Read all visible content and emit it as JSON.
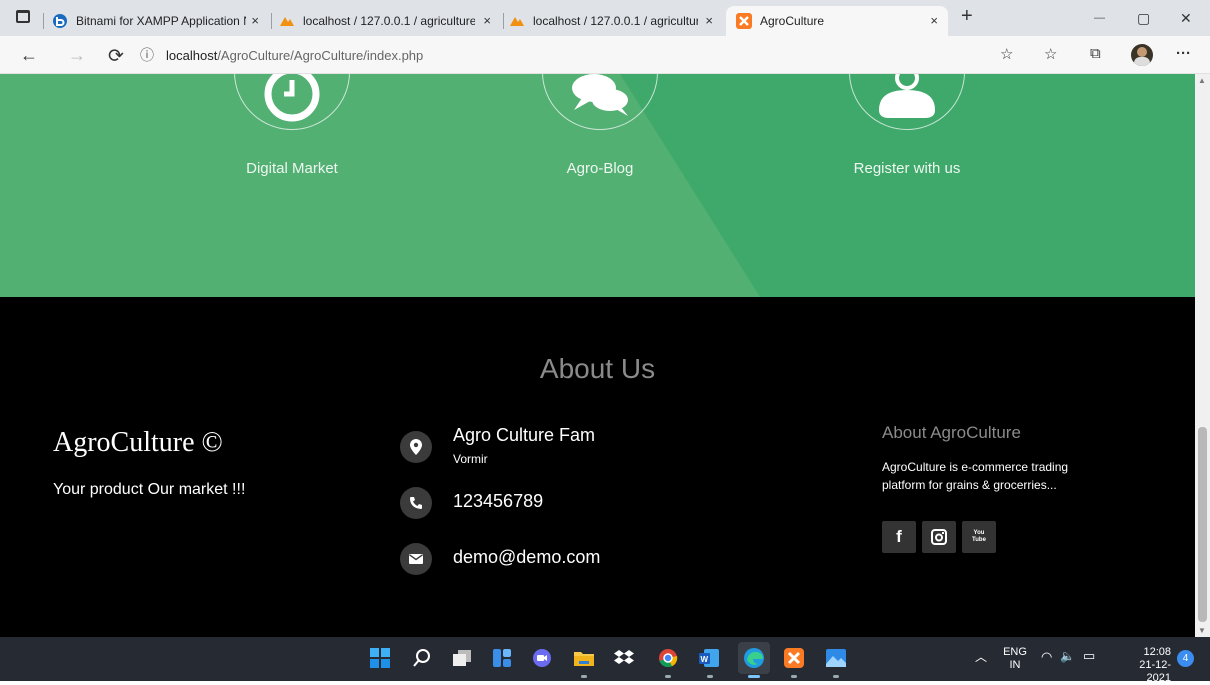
{
  "browser": {
    "tabs": [
      {
        "title": "Bitnami for XAMPP Application N",
        "close": "×"
      },
      {
        "title": "localhost / 127.0.0.1 / agriculture",
        "close": "×"
      },
      {
        "title": "localhost / 127.0.0.1 / agricultur",
        "close": "×"
      },
      {
        "title": "AgroCulture",
        "close": "×"
      }
    ],
    "new_tab": "+",
    "window_controls": {
      "minimize": "—",
      "maximize": "▢",
      "close": "✕"
    },
    "address": {
      "host": "localhost",
      "path": "/AgroCulture/AgroCulture/index.php",
      "info_icon": "ⓘ"
    }
  },
  "features": [
    {
      "label": "Digital Market",
      "icon": "clock-icon"
    },
    {
      "label": "Agro-Blog",
      "icon": "chat-bubbles-icon"
    },
    {
      "label": "Register with us",
      "icon": "user-icon"
    }
  ],
  "footer": {
    "title": "About Us",
    "brand": "AgroCulture ©",
    "tagline": "Your product Our market !!!",
    "contact": {
      "name": "Agro Culture Fam",
      "place": "Vormir",
      "phone": "123456789",
      "email": "demo@demo.com"
    },
    "about": {
      "heading": "About AgroCulture",
      "text": "AgroCulture is e-commerce trading platform for grains & grocerries...",
      "social": [
        "facebook-icon",
        "instagram-icon",
        "youtube-icon"
      ],
      "youtube_text": "You Tube"
    }
  },
  "taskbar": {
    "lang": "ENG",
    "region": "IN",
    "time": "12:08",
    "date": "21-12-2021",
    "notifications": "4"
  },
  "colors": {
    "green": "#3fa96b",
    "footer": "#000000",
    "taskbar": "#262a33"
  }
}
